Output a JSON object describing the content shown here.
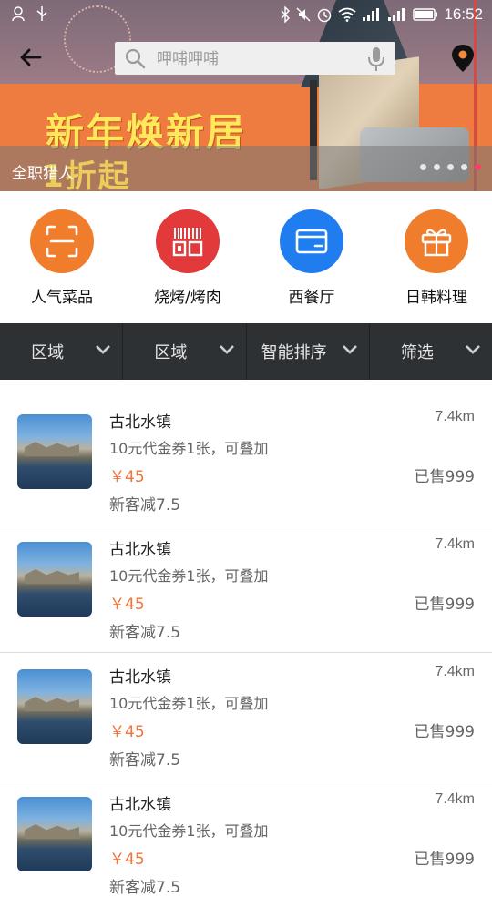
{
  "status_bar": {
    "time": "16:52"
  },
  "search": {
    "placeholder": "呷哺呷哺"
  },
  "banner": {
    "promo_line1": "新年焕新居",
    "promo_line2": "1折起",
    "caption": "全职猎人",
    "dot_count": 5,
    "active_dot": 4
  },
  "categories": [
    {
      "label": "人气菜品",
      "icon": "scan-icon",
      "color": "#f07d2c"
    },
    {
      "label": "烧烤/烤肉",
      "icon": "barcode-icon",
      "color": "#e2393a"
    },
    {
      "label": "西餐厅",
      "icon": "card-icon",
      "color": "#1f7df0"
    },
    {
      "label": "日韩料理",
      "icon": "gift-icon",
      "color": "#f07d2c"
    }
  ],
  "filters": [
    "区域",
    "区域",
    "智能排序",
    "筛选"
  ],
  "list": [
    {
      "title": "古北水镇",
      "desc": "10元代金券1张，可叠加",
      "price": "￥45",
      "extra": "新客减7.5",
      "distance": "7.4km",
      "sold": "已售999"
    },
    {
      "title": "古北水镇",
      "desc": "10元代金券1张，可叠加",
      "price": "￥45",
      "extra": "新客减7.5",
      "distance": "7.4km",
      "sold": "已售999"
    },
    {
      "title": "古北水镇",
      "desc": "10元代金券1张，可叠加",
      "price": "￥45",
      "extra": "新客减7.5",
      "distance": "7.4km",
      "sold": "已售999"
    },
    {
      "title": "古北水镇",
      "desc": "10元代金券1张，可叠加",
      "price": "￥45",
      "extra": "新客减7.5",
      "distance": "7.4km",
      "sold": "已售999"
    }
  ],
  "colors": {
    "price": "#f4733d",
    "filter_bar": "#2e3133",
    "active_dot": "#ff3e6b"
  }
}
